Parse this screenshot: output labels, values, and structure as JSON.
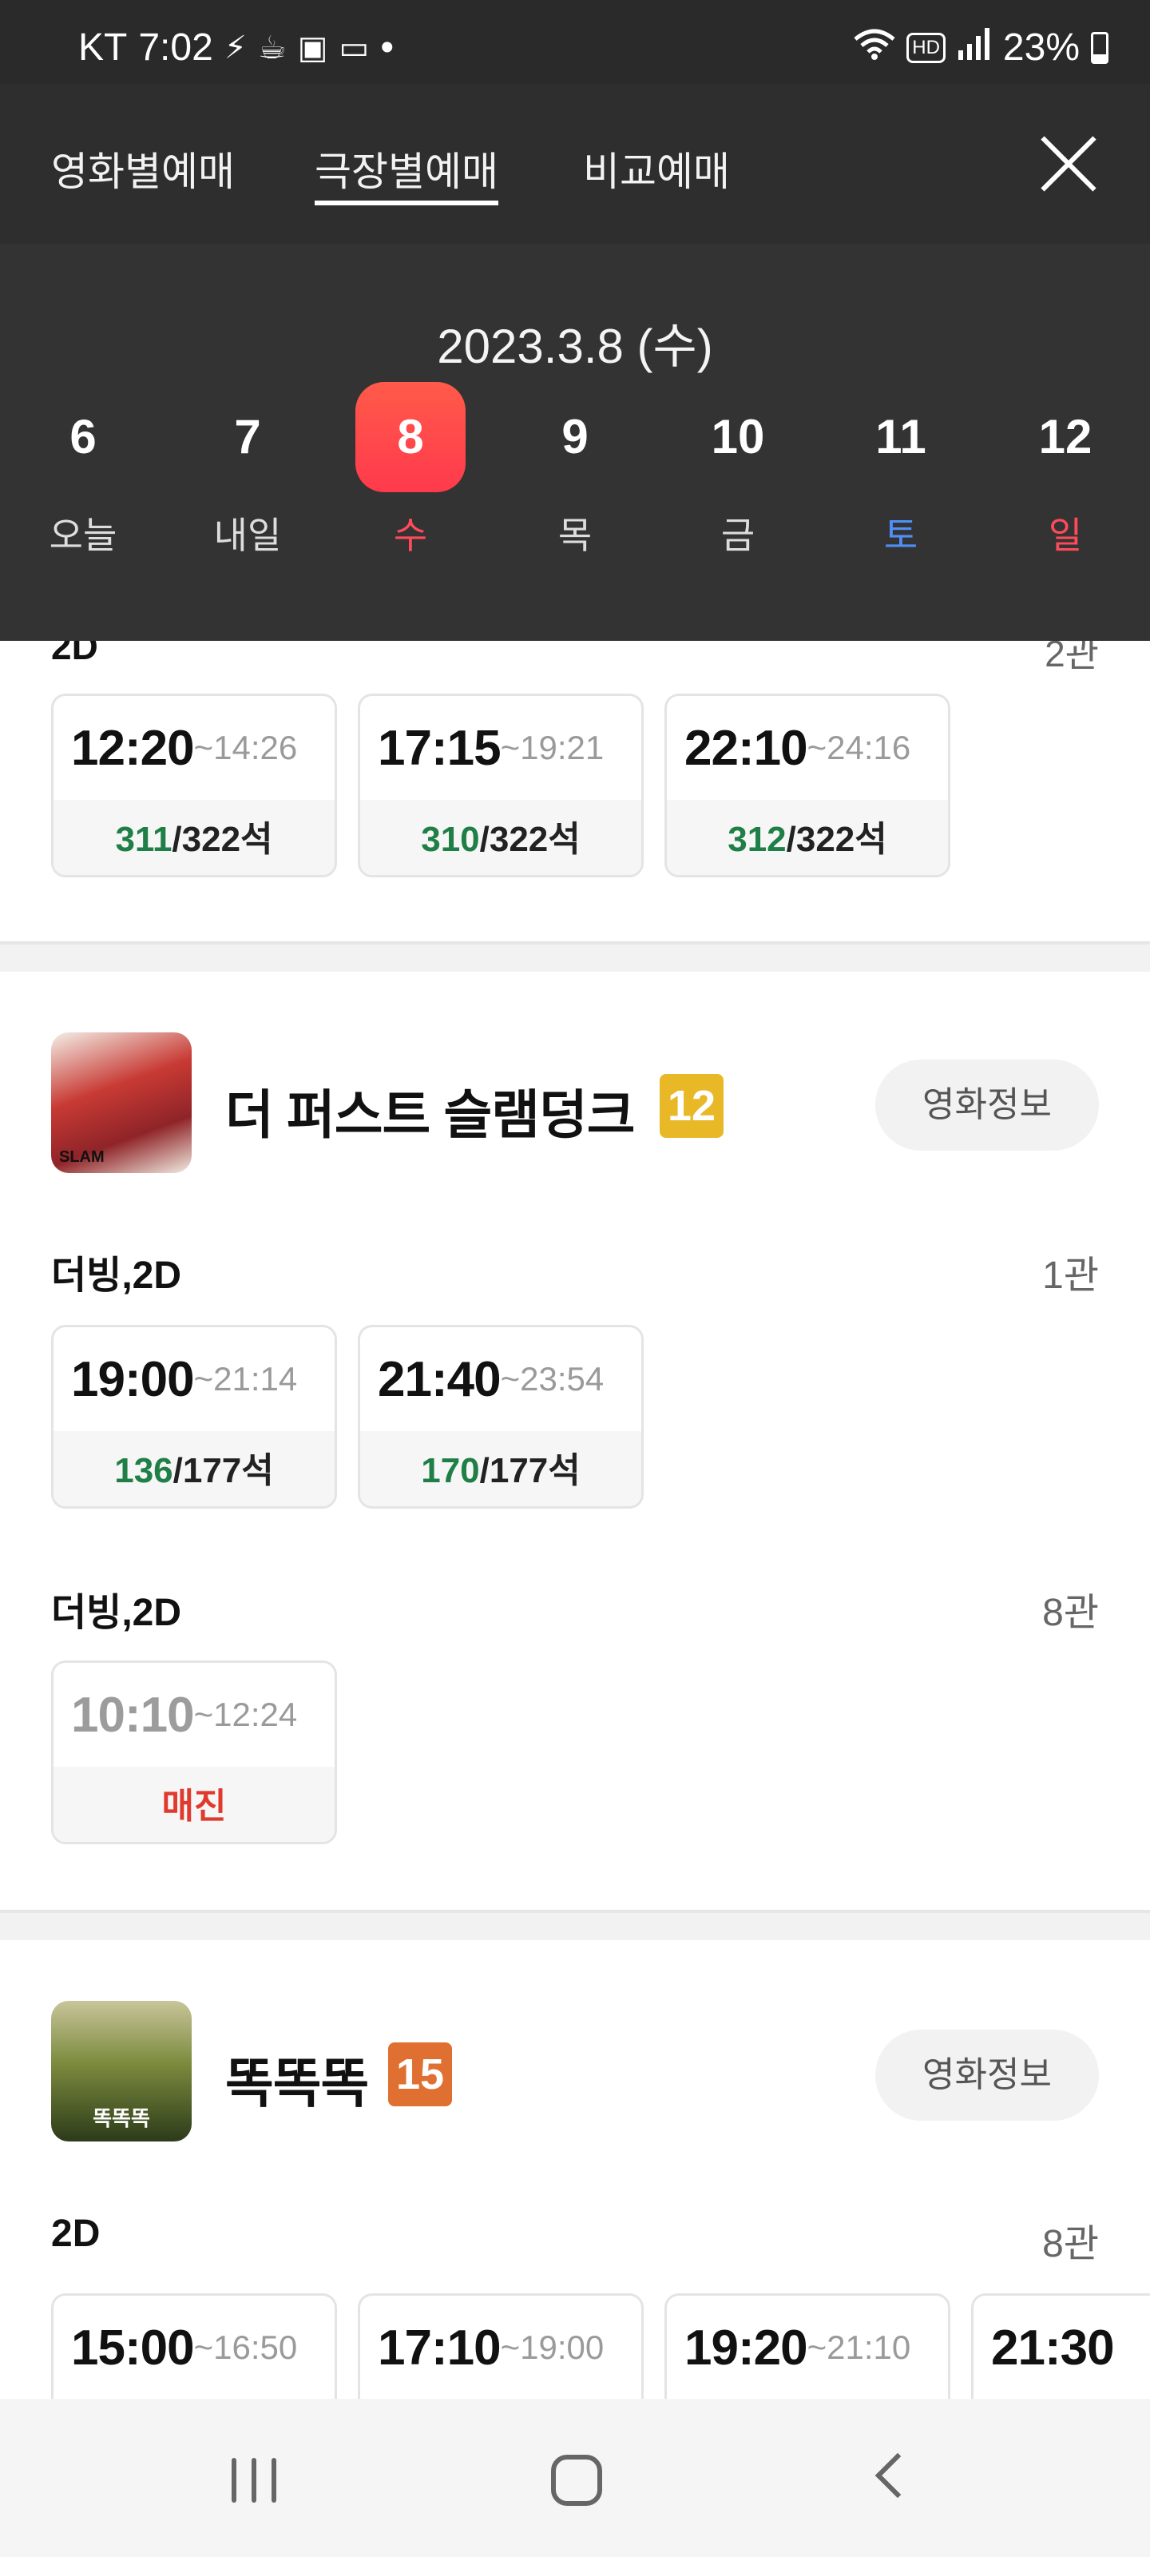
{
  "status_bar": {
    "carrier": "KT",
    "time": "7:02",
    "hd": "HD",
    "battery": "23%",
    "dot": "•"
  },
  "tabs": [
    {
      "label": "영화별예매",
      "active": false
    },
    {
      "label": "극장별예매",
      "active": true
    },
    {
      "label": "비교예매",
      "active": false
    }
  ],
  "date_title": "2023.3.8 (수)",
  "days": [
    {
      "num": "6",
      "label": "오늘"
    },
    {
      "num": "7",
      "label": "내일"
    },
    {
      "num": "8",
      "label": "수",
      "selected": true
    },
    {
      "num": "9",
      "label": "목"
    },
    {
      "num": "10",
      "label": "금"
    },
    {
      "num": "11",
      "label": "토"
    },
    {
      "num": "12",
      "label": "일"
    }
  ],
  "prev_section": {
    "format": "2D",
    "hall": "2관",
    "showtimes": [
      {
        "start": "12:20",
        "end": "~14:26",
        "avail": "311",
        "total": "/322석"
      },
      {
        "start": "17:15",
        "end": "~19:21",
        "avail": "310",
        "total": "/322석"
      },
      {
        "start": "22:10",
        "end": "~24:16",
        "avail": "312",
        "total": "/322석"
      }
    ]
  },
  "movies": [
    {
      "title": "더 퍼스트 슬램덩크",
      "rating": "12",
      "poster_text": "SLAM",
      "info_label": "영화정보",
      "groups": [
        {
          "format": "더빙,2D",
          "hall": "1관",
          "showtimes": [
            {
              "start": "19:00",
              "end": "~21:14",
              "avail": "136",
              "total": "/177석"
            },
            {
              "start": "21:40",
              "end": "~23:54",
              "avail": "170",
              "total": "/177석"
            }
          ]
        },
        {
          "format": "더빙,2D",
          "hall": "8관",
          "showtimes": [
            {
              "start": "10:10",
              "end": "~12:24",
              "status": "매진"
            }
          ]
        }
      ]
    },
    {
      "title": "똑똑똑",
      "rating": "15",
      "poster_text": "똑똑똑",
      "info_label": "영화정보",
      "groups": [
        {
          "format": "2D",
          "hall": "8관",
          "showtimes": [
            {
              "start": "15:00",
              "end": "~16:50"
            },
            {
              "start": "17:10",
              "end": "~19:00"
            },
            {
              "start": "19:20",
              "end": "~21:10"
            },
            {
              "start": "21:30",
              "end": ""
            }
          ]
        }
      ]
    }
  ],
  "colors": {
    "header_bg": "#333333",
    "selected_day": "#ff4a4a",
    "sunday": "#ff4a5a",
    "saturday": "#4f8ff7",
    "seats_available": "#1f7f46",
    "sold_out": "#e03a2e",
    "rating_12": "#e8b827",
    "rating_15": "#e07031"
  },
  "icons": {
    "status": [
      "flash-icon",
      "coffee-icon",
      "app-icon",
      "wallet-icon"
    ],
    "status_right": [
      "wifi-icon",
      "signal-icon",
      "battery-icon"
    ],
    "nav": [
      "recents-icon",
      "home-icon",
      "back-icon"
    ],
    "close": "close-icon"
  }
}
